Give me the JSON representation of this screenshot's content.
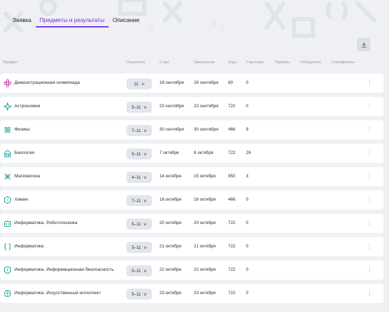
{
  "tabs": [
    {
      "label": "Заявка",
      "active": false
    },
    {
      "label": "Предметы и результаты",
      "active": true
    },
    {
      "label": "Описание",
      "active": false
    }
  ],
  "download_icon": "download-icon",
  "columns": {
    "subject": "Предмет",
    "grade": "Параллель",
    "start": "Старт",
    "end": "Завершение",
    "codes": "Коды",
    "participants": "Участники",
    "winners": "Призёры",
    "victors": "Победители",
    "certificates": "Сертификаты"
  },
  "accent_color": "#7c3aed",
  "icon_color": "#1aa39a",
  "rows": [
    {
      "icon": "flower-icon",
      "subject": "Демонстрационная олимпиада",
      "grade": "11",
      "start": "18 сентября",
      "end": "26 сентября",
      "codes": "60",
      "participants": "0"
    },
    {
      "icon": "star-icon",
      "subject": "Астрономия",
      "grade": "5–11",
      "start": "23 сентября",
      "end": "23 сентября",
      "codes": "722",
      "participants": "0"
    },
    {
      "icon": "atom-icon",
      "subject": "Физика",
      "grade": "7–11",
      "start": "30 сентября",
      "end": "30 сентября",
      "codes": "466",
      "participants": "9"
    },
    {
      "icon": "leaf-icon",
      "subject": "Биология",
      "grade": "5–11",
      "start": "7 октября",
      "end": "8 октября",
      "codes": "722",
      "participants": "26"
    },
    {
      "icon": "math-icon",
      "subject": "Математика",
      "grade": "4–11",
      "start": "14 октября",
      "end": "15 октября",
      "codes": "850",
      "participants": "3"
    },
    {
      "icon": "hexagon-icon",
      "subject": "Химия",
      "grade": "7–11",
      "start": "16 октября",
      "end": "16 октября",
      "codes": "466",
      "participants": "0"
    },
    {
      "icon": "robot-icon",
      "subject": "Информатика. Робототехника",
      "grade": "5–11",
      "start": "20 октября",
      "end": "20 октября",
      "codes": "722",
      "participants": "0"
    },
    {
      "icon": "braces-icon",
      "subject": "Информатика",
      "grade": "5–11",
      "start": "21 октября",
      "end": "21 октября",
      "codes": "722",
      "participants": "0"
    },
    {
      "icon": "shield-icon",
      "subject": "Информатика. Информационная безопасность",
      "grade": "5–11",
      "start": "22 октября",
      "end": "22 октября",
      "codes": "722",
      "participants": "0"
    },
    {
      "icon": "brain-icon",
      "subject": "Информатика. Искусственный интеллект",
      "grade": "5–11",
      "start": "23 октября",
      "end": "23 октября",
      "codes": "722",
      "participants": "0"
    }
  ]
}
